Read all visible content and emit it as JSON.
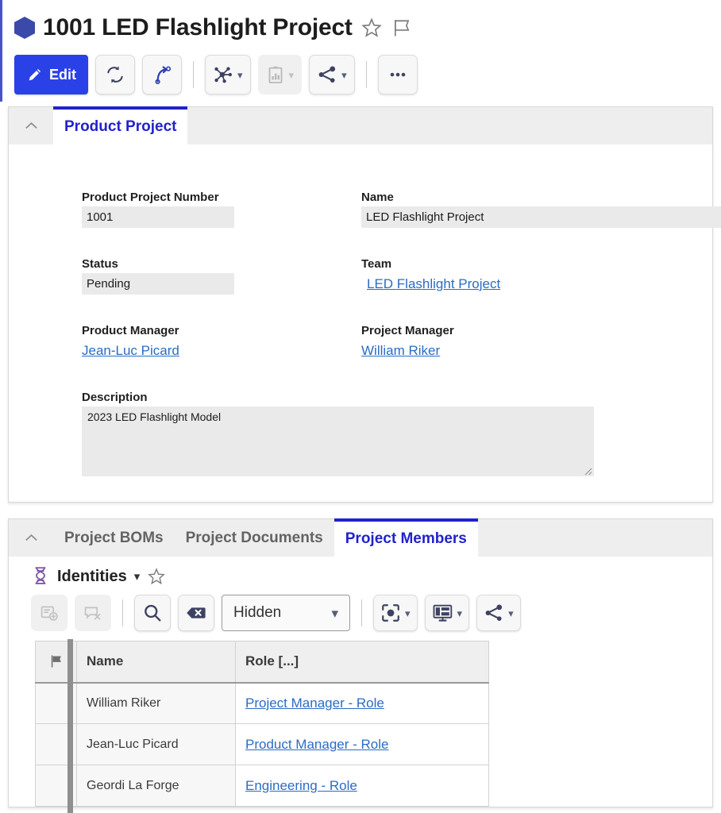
{
  "header": {
    "record_icon": "hexagon-icon",
    "title": "1001 LED Flashlight Project",
    "favorite_icon": "star-icon",
    "flag_icon": "flag-icon"
  },
  "toolbar": {
    "edit_label": "Edit",
    "buttons": [
      {
        "name": "edit-button",
        "label": "Edit",
        "icon": "pencil-icon",
        "primary": true,
        "disabled": false,
        "dropdown": false
      },
      {
        "name": "refresh-button",
        "label": "",
        "icon": "sync-icon",
        "primary": false,
        "disabled": false,
        "dropdown": false
      },
      {
        "name": "revise-button",
        "label": "",
        "icon": "curved-arrow-icon",
        "primary": false,
        "disabled": false,
        "dropdown": false
      },
      {
        "name": "relations-button",
        "label": "",
        "icon": "network-hub-icon",
        "primary": false,
        "disabled": false,
        "dropdown": true
      },
      {
        "name": "reports-button",
        "label": "",
        "icon": "clipboard-chart-icon",
        "primary": false,
        "disabled": true,
        "dropdown": true
      },
      {
        "name": "share-button",
        "label": "",
        "icon": "share-icon",
        "primary": false,
        "disabled": false,
        "dropdown": true
      },
      {
        "name": "more-button",
        "label": "",
        "icon": "ellipsis-icon",
        "primary": false,
        "disabled": false,
        "dropdown": false
      }
    ]
  },
  "main_panel": {
    "collapse_icon": "chevron-up-icon",
    "tabs": [
      {
        "label": "Product Project",
        "active": true
      }
    ],
    "fields": {
      "product_project_number": {
        "label": "Product Project Number",
        "value": "1001"
      },
      "name": {
        "label": "Name",
        "value": "LED Flashlight Project"
      },
      "status": {
        "label": "Status",
        "value": "Pending"
      },
      "team": {
        "label": "Team",
        "value": "LED Flashlight Project",
        "is_link": true
      },
      "product_manager": {
        "label": "Product Manager",
        "value": "Jean-Luc Picard",
        "is_link": true
      },
      "project_manager": {
        "label": "Project Manager",
        "value": "William Riker",
        "is_link": true
      },
      "description": {
        "label": "Description",
        "value": "2023 LED Flashlight Model"
      }
    }
  },
  "bottom_panel": {
    "collapse_icon": "chevron-up-icon",
    "tabs": [
      {
        "label": "Project BOMs",
        "active": false
      },
      {
        "label": "Project Documents",
        "active": false
      },
      {
        "label": "Project Members",
        "active": true
      }
    ],
    "sub_header": {
      "icon": "dna-helix-icon",
      "title": "Identities",
      "dropdown_icon": "chevron-down-icon",
      "favorite_icon": "star-icon"
    },
    "sub_toolbar": {
      "buttons": [
        {
          "name": "add-item-button",
          "icon": "add-record-icon",
          "disabled": true,
          "dropdown": false
        },
        {
          "name": "remove-item-button",
          "icon": "remove-record-icon",
          "disabled": true,
          "dropdown": false
        },
        {
          "name": "search-button",
          "icon": "search-icon",
          "disabled": false,
          "dropdown": false
        },
        {
          "name": "clear-search-button",
          "icon": "clear-tag-icon",
          "disabled": false,
          "dropdown": false
        },
        {
          "name": "focus-button",
          "icon": "focus-target-icon",
          "disabled": false,
          "dropdown": true
        },
        {
          "name": "layout-button",
          "icon": "display-layout-icon",
          "disabled": false,
          "dropdown": true
        },
        {
          "name": "share-button",
          "icon": "share-icon",
          "disabled": false,
          "dropdown": true
        }
      ],
      "visibility_select": {
        "label": "Hidden",
        "icon": "chevron-down-icon"
      }
    },
    "table": {
      "columns": [
        {
          "key": "flag",
          "label": "",
          "icon": "flag-icon"
        },
        {
          "key": "name",
          "label": "Name"
        },
        {
          "key": "role",
          "label": "Role [...]"
        }
      ],
      "rows": [
        {
          "flag": "",
          "name": "William Riker",
          "role": "Project Manager - Role"
        },
        {
          "flag": "",
          "name": "Jean-Luc Picard",
          "role": "Product Manager - Role"
        },
        {
          "flag": "",
          "name": "Geordi La Forge",
          "role": "Engineering - Role"
        }
      ]
    }
  },
  "colors": {
    "accent_blue": "#2b41e8",
    "tab_active": "#2222cc",
    "link_blue": "#2b6cc4",
    "dna_purple": "#7b4fa8",
    "icon_navy": "#3d4162"
  }
}
